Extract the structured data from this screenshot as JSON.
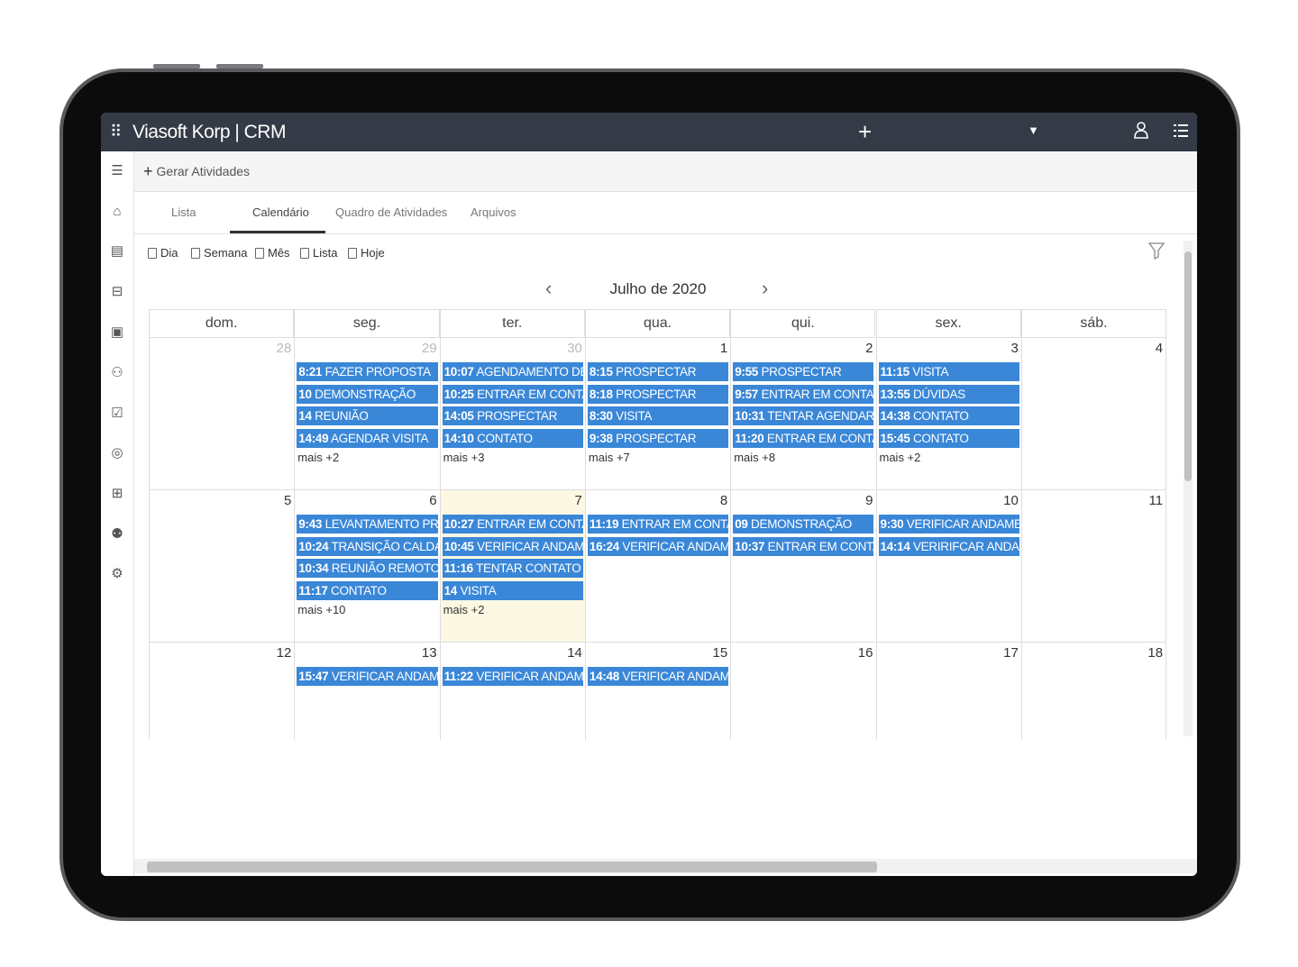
{
  "app": {
    "title": "Viasoft Korp | CRM"
  },
  "actions": {
    "generate": "Gerar Atividades"
  },
  "tabs": [
    {
      "label": "Lista"
    },
    {
      "label": "Calendário"
    },
    {
      "label": "Quadro de Atividades"
    },
    {
      "label": "Arquivos"
    }
  ],
  "views": [
    "Dia",
    "Semana",
    "Mês",
    "Lista",
    "Hoje"
  ],
  "calendar": {
    "title": "Julho de 2020",
    "weekdays": [
      "dom.",
      "seg.",
      "ter.",
      "qua.",
      "qui.",
      "sex.",
      "sáb."
    ],
    "weeks": [
      [
        {
          "day": "28",
          "other": true,
          "events": []
        },
        {
          "day": "29",
          "other": true,
          "events": [
            {
              "time": "8:21",
              "title": "FAZER PROPOSTA"
            },
            {
              "time": "10",
              "title": "DEMONSTRAÇÃO"
            },
            {
              "time": "14",
              "title": "REUNIÃO"
            },
            {
              "time": "14:49",
              "title": "AGENDAR VISITA"
            }
          ],
          "more": "mais +2"
        },
        {
          "day": "30",
          "other": true,
          "events": [
            {
              "time": "10:07",
              "title": "AGENDAMENTO DE"
            },
            {
              "time": "10:25",
              "title": "ENTRAR EM CONTA"
            },
            {
              "time": "14:05",
              "title": "PROSPECTAR"
            },
            {
              "time": "14:10",
              "title": "CONTATO"
            }
          ],
          "more": "mais +3"
        },
        {
          "day": "1",
          "events": [
            {
              "time": "8:15",
              "title": "PROSPECTAR"
            },
            {
              "time": "8:18",
              "title": "PROSPECTAR"
            },
            {
              "time": "8:30",
              "title": "VISITA"
            },
            {
              "time": "9:38",
              "title": "PROSPECTAR"
            }
          ],
          "more": "mais +7"
        },
        {
          "day": "2",
          "events": [
            {
              "time": "9:55",
              "title": "PROSPECTAR"
            },
            {
              "time": "9:57",
              "title": "ENTRAR EM CONTATO"
            },
            {
              "time": "10:31",
              "title": "TENTAR AGENDAR V"
            },
            {
              "time": "11:20",
              "title": "ENTRAR EM CONTA"
            }
          ],
          "more": "mais +8"
        },
        {
          "day": "3",
          "events": [
            {
              "time": "11:15",
              "title": "VISITA"
            },
            {
              "time": "13:55",
              "title": "DÚVIDAS"
            },
            {
              "time": "14:38",
              "title": "CONTATO"
            },
            {
              "time": "15:45",
              "title": "CONTATO"
            }
          ],
          "more": "mais +2"
        },
        {
          "day": "4",
          "events": []
        }
      ],
      [
        {
          "day": "5",
          "events": []
        },
        {
          "day": "6",
          "events": [
            {
              "time": "9:43",
              "title": "LEVANTAMENTO PRO"
            },
            {
              "time": "10:24",
              "title": "TRANSIÇÃO CALDAI"
            },
            {
              "time": "10:34",
              "title": "REUNIÃO REMOTO"
            },
            {
              "time": "11:17",
              "title": "CONTATO"
            }
          ],
          "more": "mais +10"
        },
        {
          "day": "7",
          "today": true,
          "events": [
            {
              "time": "10:27",
              "title": "ENTRAR EM CONTA"
            },
            {
              "time": "10:45",
              "title": "VERIFICAR ANDAME"
            },
            {
              "time": "11:16",
              "title": "TENTAR CONTATO"
            },
            {
              "time": "14",
              "title": "VISITA"
            }
          ],
          "more": "mais +2"
        },
        {
          "day": "8",
          "events": [
            {
              "time": "11:19",
              "title": "ENTRAR EM CONTA"
            },
            {
              "time": "16:24",
              "title": "VERIFICAR ANDAME"
            }
          ]
        },
        {
          "day": "9",
          "events": [
            {
              "time": "09",
              "title": "DEMONSTRAÇÃO"
            },
            {
              "time": "10:37",
              "title": "ENTRAR EM CONTA"
            }
          ]
        },
        {
          "day": "10",
          "events": [
            {
              "time": "9:30",
              "title": "VERIFICAR ANDAMEN"
            },
            {
              "time": "14:14",
              "title": "VERIRIFCAR ANDAM"
            }
          ]
        },
        {
          "day": "11",
          "events": []
        }
      ],
      [
        {
          "day": "12",
          "events": []
        },
        {
          "day": "13",
          "events": [
            {
              "time": "15:47",
              "title": "VERIFICAR ANDAME"
            }
          ]
        },
        {
          "day": "14",
          "events": [
            {
              "time": "11:22",
              "title": "VERIFICAR ANDAME"
            }
          ]
        },
        {
          "day": "15",
          "events": [
            {
              "time": "14:48",
              "title": "VERIFICAR ANDAME"
            }
          ]
        },
        {
          "day": "16",
          "events": []
        },
        {
          "day": "17",
          "events": []
        },
        {
          "day": "18",
          "events": []
        }
      ]
    ]
  },
  "colors": {
    "topbar": "#343a46",
    "event": "#3a87d8",
    "today": "#fcf8e3"
  },
  "icons": [
    "apps-grid-icon",
    "plus-icon",
    "caret-down-icon",
    "user-icon",
    "list-menu-icon",
    "hamburger-icon",
    "home-icon",
    "document-icon",
    "briefcase-icon",
    "contact-card-icon",
    "network-people-icon",
    "clipboard-icon",
    "badge-icon",
    "org-chart-icon",
    "user-settings-icon",
    "gear-icon",
    "filter-icon",
    "chevron-left-icon",
    "chevron-right-icon"
  ]
}
